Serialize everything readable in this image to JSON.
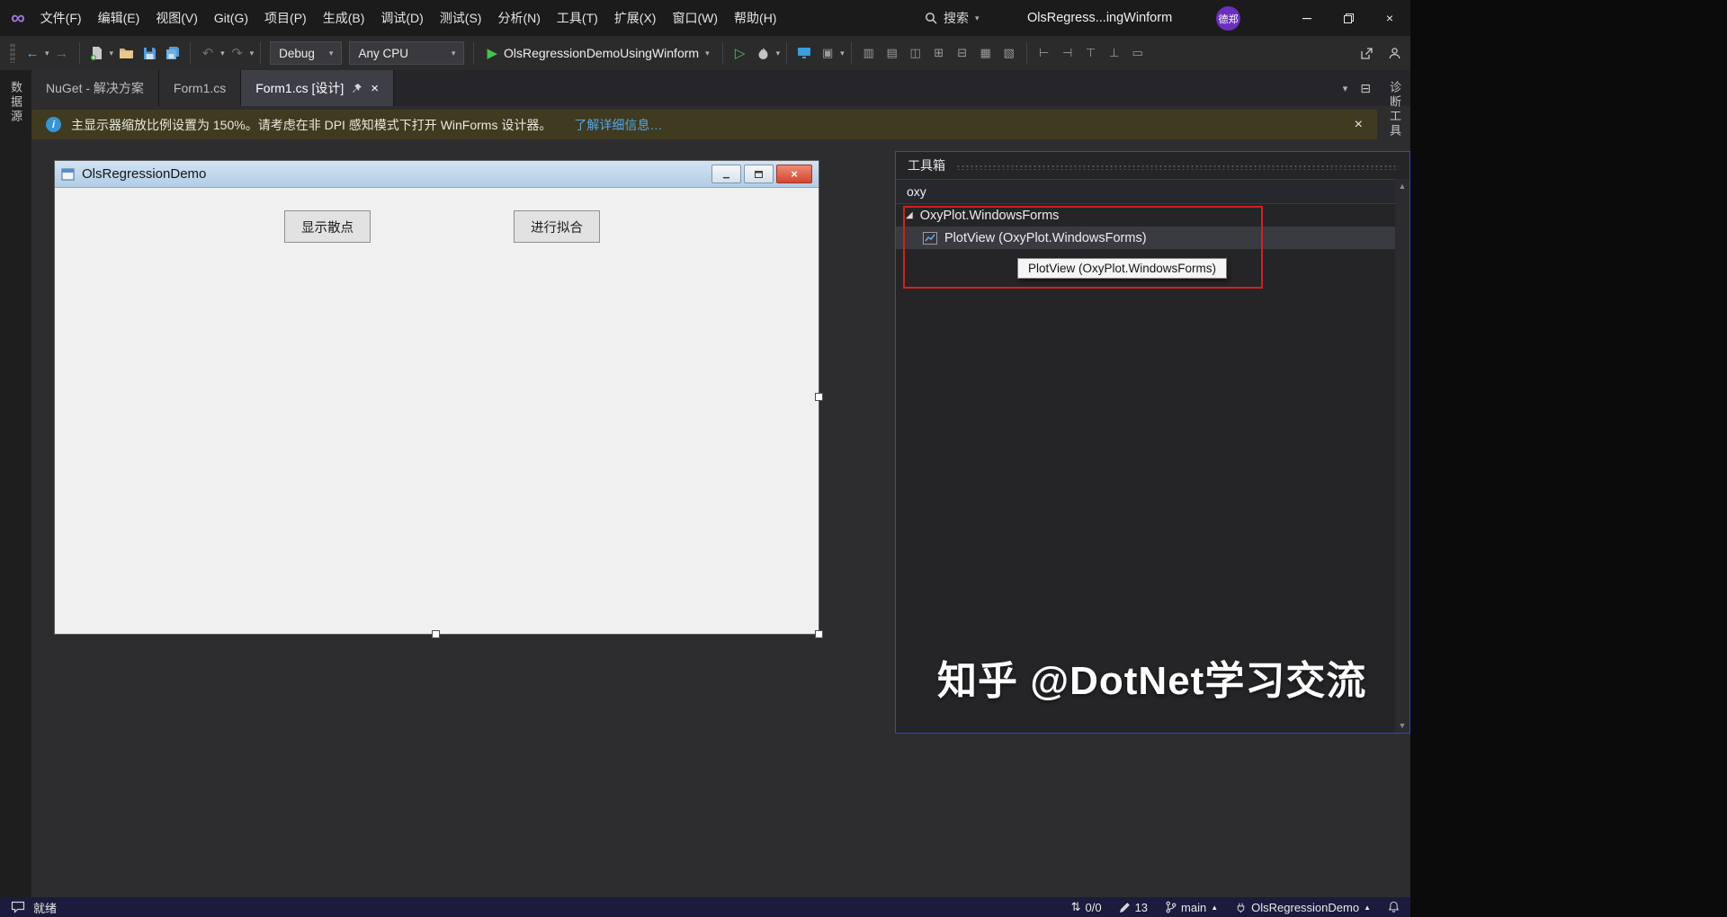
{
  "titlebar": {
    "menu": [
      "文件(F)",
      "编辑(E)",
      "视图(V)",
      "Git(G)",
      "项目(P)",
      "生成(B)",
      "调试(D)",
      "测试(S)",
      "分析(N)",
      "工具(T)",
      "扩展(X)",
      "窗口(W)",
      "帮助(H)"
    ],
    "search_label": "搜索",
    "window_title": "OlsRegress...ingWinform",
    "account_badge": "德郑"
  },
  "toolbar": {
    "configuration": "Debug",
    "platform": "Any CPU",
    "run_target": "OlsRegressionDemoUsingWinform"
  },
  "tabs": {
    "nuget": "NuGet - 解决方案",
    "form_code": "Form1.cs",
    "form_designer": "Form1.cs [设计]"
  },
  "infobar": {
    "message": "主显示器缩放比例设置为 150%。请考虑在非 DPI 感知模式下打开 WinForms 设计器。",
    "link": "了解详细信息…"
  },
  "side_tabs": {
    "left": "数据源",
    "right": "诊断工具"
  },
  "designer": {
    "form_title": "OlsRegressionDemo",
    "button_scatter": "显示散点",
    "button_fit": "进行拟合"
  },
  "toolbox": {
    "title": "工具箱",
    "search_value": "oxy",
    "group_label": "OxyPlot.WindowsForms",
    "item_label": "PlotView (OxyPlot.WindowsForms)",
    "tooltip": "PlotView (OxyPlot.WindowsForms)"
  },
  "watermark": "知乎 @DotNet学习交流",
  "statusbar": {
    "ready": "就绪",
    "sync_count": "0/0",
    "pending_edits": "13",
    "branch": "main",
    "project": "OlsRegressionDemo"
  },
  "colors": {
    "annotation_red": "#cf2222",
    "toolbox_border_blue": "#3742c9",
    "infobar_bg": "#403a20",
    "run_green": "#45c24e",
    "form_close_red": "#d5452f",
    "statusbar_bg": "#1b1b3d",
    "accent_link": "#53a7e8"
  }
}
